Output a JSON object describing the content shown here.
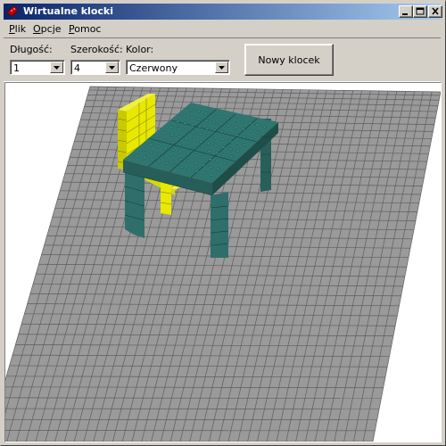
{
  "window": {
    "title": "Wirtualne klocki",
    "title_colors": {
      "start": "#0a246a",
      "end": "#a6caf0"
    }
  },
  "menu": [
    {
      "label": "Plik",
      "accel": "P"
    },
    {
      "label": "Opcje",
      "accel": "O"
    },
    {
      "label": "Pomoc",
      "accel": "P"
    }
  ],
  "toolbar": {
    "length": {
      "label": "Długość:",
      "value": "1"
    },
    "width": {
      "label": "Szerokość:",
      "value": "4"
    },
    "color": {
      "label": "Kolor:",
      "value": "Czerwony"
    },
    "new_brick_label": "Nowy klocek"
  },
  "scene": {
    "background": "#ffffff",
    "floor_color": "#9a9a9a",
    "grid_color": "#5e5e5e",
    "objects": [
      {
        "name": "chair",
        "color": "#e8e800"
      },
      {
        "name": "table",
        "color": "#2f6f6b"
      }
    ]
  },
  "icons": [
    "brick-app-icon",
    "minimize-icon",
    "maximize-icon",
    "close-icon",
    "chevron-down-icon"
  ]
}
